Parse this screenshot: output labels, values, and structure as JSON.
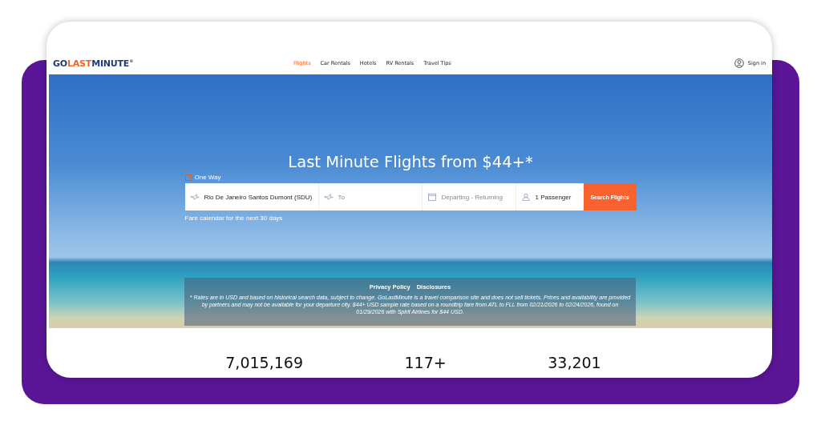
{
  "logo": {
    "prefix": "GO",
    "highlight": "LAST",
    "suffix": "MINUTE",
    "mark": "®"
  },
  "nav": [
    {
      "label": "Flights",
      "selected": true
    },
    {
      "label": "Car Rentals",
      "selected": false
    },
    {
      "label": "Hotels",
      "selected": false
    },
    {
      "label": "RV Rentals",
      "selected": false
    },
    {
      "label": "Travel Tips",
      "selected": false
    }
  ],
  "sign_in": "Sign in",
  "hero": {
    "title": "Last Minute Flights from $44+*",
    "one_way": {
      "label": "One Way",
      "checked": false
    },
    "fields": [
      {
        "kind": "from",
        "value": "Rio De Janeiro Santos Dumont (SDU)"
      },
      {
        "kind": "to",
        "placeholder": "To"
      },
      {
        "kind": "dates",
        "placeholder": "Departing - Returning"
      },
      {
        "kind": "passengers",
        "value": "1 Passenger"
      }
    ],
    "search_button": "Search Flights",
    "fare_calendar": "Fare calendar for the next 30 days"
  },
  "disclaimer": {
    "links": [
      "Privacy Policy",
      "Disclosures"
    ],
    "text": "* Rates are in USD and based on historical search data, subject to change. GoLastMinute is a travel comparison site and does not sell tickets. Prices and availability are provided by partners and may not be available for your departure city. $44+ USD sample rate based on a roundtrip fare from ATL to FLL from 02/21/2026 to 02/24/2026, found on 01/29/2026 with Spirit Airlines for $44 USD."
  },
  "stats": [
    "7,015,169",
    "117+",
    "33,201"
  ]
}
